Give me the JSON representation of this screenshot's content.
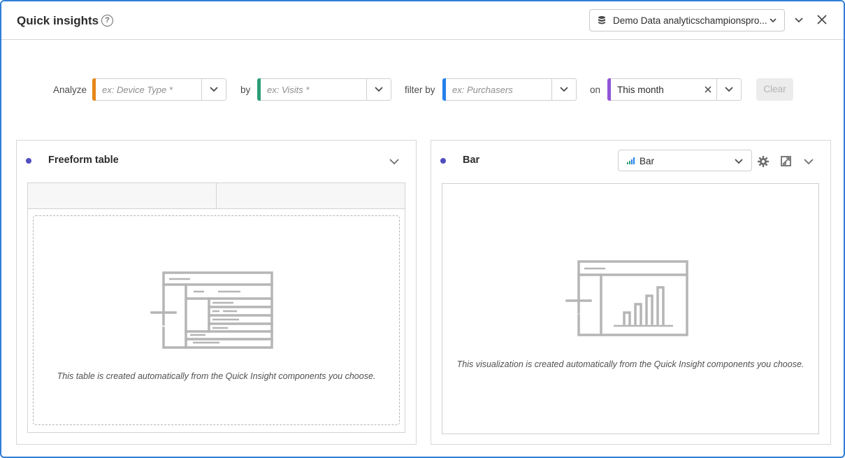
{
  "header": {
    "title": "Quick insights",
    "help_symbol": "?",
    "datasource": "Demo Data analyticschampionspro..."
  },
  "builder": {
    "analyze_label": "Analyze",
    "analyze_placeholder": "ex: Device Type *",
    "by_label": "by",
    "by_placeholder": "ex: Visits *",
    "filter_label": "filter by",
    "filter_placeholder": "ex: Purchasers",
    "on_label": "on",
    "date_value": "This month",
    "clear_label": "Clear",
    "colors": {
      "analyze": "#e68619",
      "by": "#2d9d78",
      "filter": "#2680eb",
      "date": "#9256d9"
    }
  },
  "panels": {
    "table": {
      "title": "Freeform table",
      "hint": "This table is created automatically from the Quick Insight components you choose."
    },
    "viz": {
      "title": "Bar",
      "type_value": "Bar",
      "hint": "This visualization is created automatically from the Quick Insight components you choose."
    }
  }
}
